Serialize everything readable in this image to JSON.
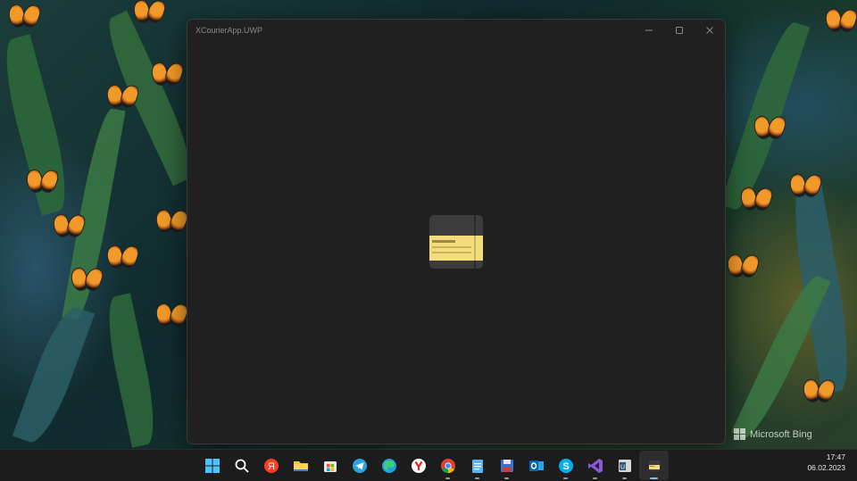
{
  "window": {
    "title": "XCourierApp.UWP",
    "minimize_icon": "minimize-icon",
    "maximize_icon": "maximize-icon",
    "close_icon": "close-icon",
    "background": "#202020",
    "splash_icon": "notebook-card-icon",
    "splash_colors": {
      "book": "#3c3c3c",
      "card": "#f3dc79",
      "line": "#9c8a48"
    }
  },
  "wallpaper": {
    "watermark_text": "Microsoft Bing",
    "watermark_icon": "bing-logo-icon"
  },
  "taskbar": {
    "items": [
      {
        "icon": "windows-start-icon",
        "running": false
      },
      {
        "icon": "search-icon",
        "running": false
      },
      {
        "icon": "yandex-icon",
        "running": false
      },
      {
        "icon": "file-explorer-icon",
        "running": false
      },
      {
        "icon": "microsoft-store-icon",
        "running": false
      },
      {
        "icon": "telegram-icon",
        "running": false
      },
      {
        "icon": "edge-icon",
        "running": false
      },
      {
        "icon": "yandex-browser-icon",
        "running": false
      },
      {
        "icon": "chrome-icon",
        "running": true
      },
      {
        "icon": "notepad-icon",
        "running": true
      },
      {
        "icon": "save-disk-icon",
        "running": true
      },
      {
        "icon": "outlook-icon",
        "running": false
      },
      {
        "icon": "skype-icon",
        "running": true
      },
      {
        "icon": "visual-studio-icon",
        "running": true
      },
      {
        "icon": "terminal-app-icon",
        "running": true
      },
      {
        "icon": "xcourier-app-icon",
        "running": true,
        "active": true
      }
    ],
    "clock": {
      "time": "17:47",
      "date": "06.02.2023"
    }
  }
}
